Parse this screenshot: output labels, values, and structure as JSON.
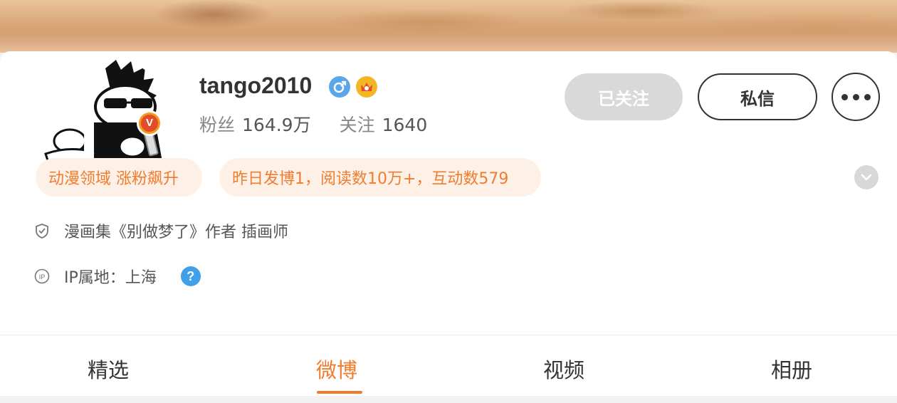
{
  "profile": {
    "username": "tango2010",
    "fans_label": "粉丝",
    "fans_value": "164.9万",
    "following_label": "关注",
    "following_value": "1640",
    "badges": [
      "vip-verified-icon",
      "crown-icon",
      "verified-v-badge"
    ]
  },
  "actions": {
    "followed_label": "已关注",
    "message_label": "私信",
    "more_icon": "more-dots-icon"
  },
  "tags": [
    {
      "text": "动漫领域 涨粉飙升"
    },
    {
      "text": "昨日发博1，阅读数10万+，互动数579"
    }
  ],
  "info": {
    "bio": "漫画集《别做梦了》作者 插画师",
    "ip": "IP属地：上海"
  },
  "tabs": [
    {
      "label": "精选"
    },
    {
      "label": "微博"
    },
    {
      "label": "视频"
    },
    {
      "label": "相册"
    }
  ],
  "active_tab": "微博",
  "colors": {
    "accent": "#f07c30",
    "tag_bg": "#fdf1e7",
    "followed_bg": "#d9d9d9",
    "help_blue": "#3f9fe8"
  }
}
